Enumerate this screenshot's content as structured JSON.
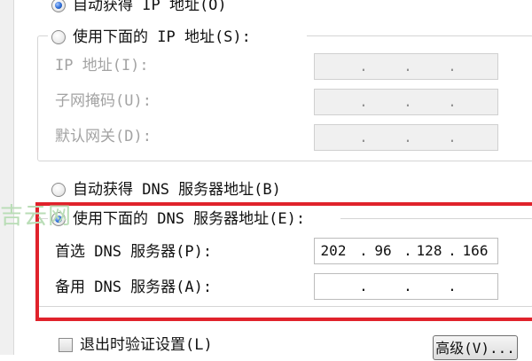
{
  "ip_section": {
    "auto_label": "自动获得 IP 地址(O)",
    "manual_label": "使用下面的 IP 地址(S):",
    "ip_label": "IP 地址(I):",
    "mask_label": "子网掩码(U):",
    "gateway_label": "默认网关(D):"
  },
  "dns_section": {
    "auto_label": "自动获得 DNS 服务器地址(B)",
    "manual_label": "使用下面的 DNS 服务器地址(E):",
    "preferred_label": "首选 DNS 服务器(P):",
    "alternate_label": "备用 DNS 服务器(A):",
    "preferred_value": [
      "202",
      "96",
      "128",
      "166"
    ],
    "alternate_value": [
      "",
      "",
      "",
      ""
    ]
  },
  "footer": {
    "validate_label": "退出时验证设置(L)",
    "advanced_label": "高级(V)..."
  },
  "watermark": "吉云网",
  "colors": {
    "highlight": "#e0222b",
    "selected_radio": "#2b6cd6"
  }
}
